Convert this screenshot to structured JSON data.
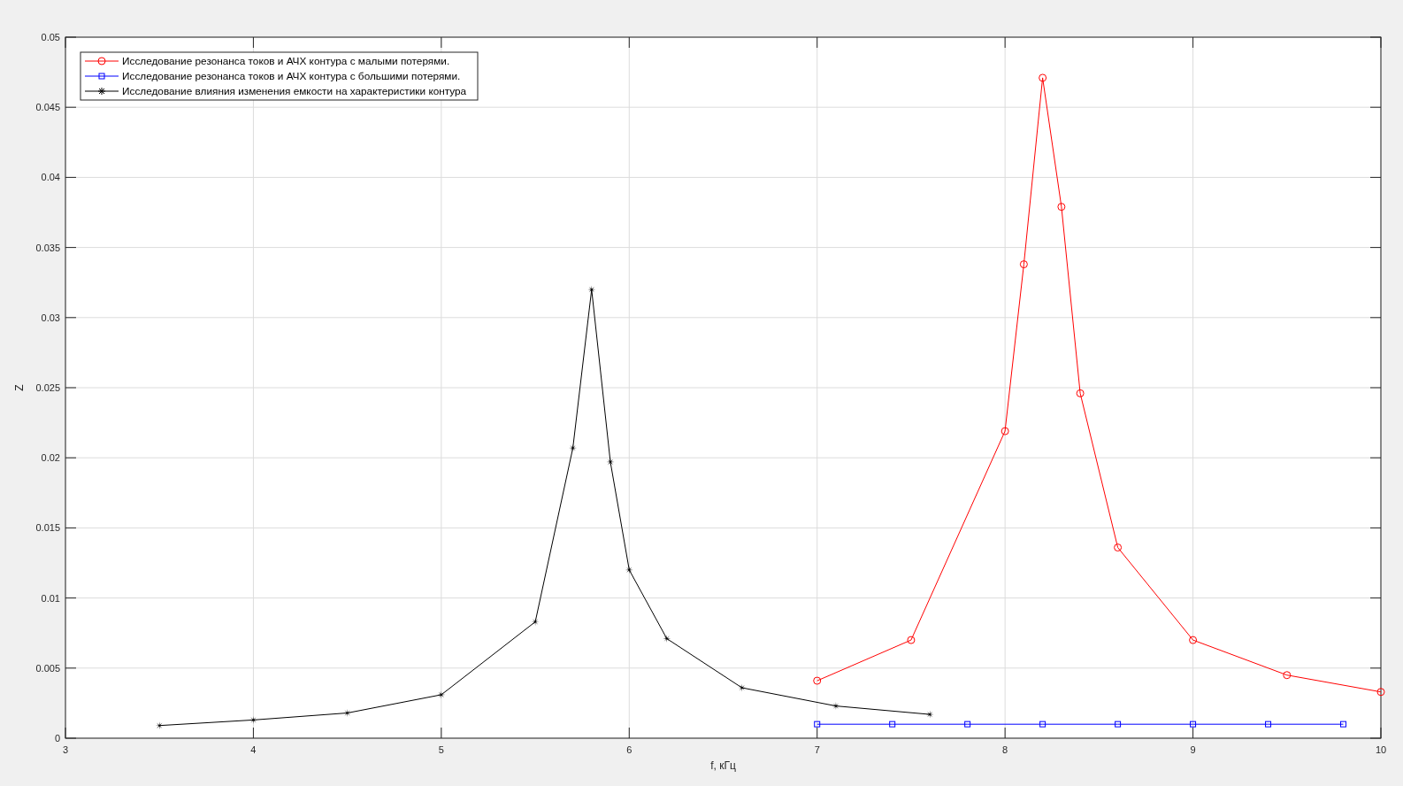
{
  "figure": {
    "chart_data": {
      "type": "line",
      "grid": true,
      "legend": true,
      "xlabel": "f, кГц",
      "ylabel": "Z",
      "xlim": [
        3,
        10
      ],
      "ylim": [
        0,
        0.05
      ],
      "xticks": [
        3,
        4,
        5,
        6,
        7,
        8,
        9,
        10
      ],
      "yticks": [
        0,
        0.005,
        0.01,
        0.015,
        0.02,
        0.025,
        0.03,
        0.035,
        0.04,
        0.045,
        0.05
      ],
      "series": [
        {
          "name": "Исследование резонанса токов и АЧХ контура с малыми потерями.",
          "color": "#ff0000",
          "marker": "circle",
          "x": [
            7,
            7.5,
            8,
            8.1,
            8.2,
            8.3,
            8.4,
            8.6,
            9,
            9.5,
            10
          ],
          "values": [
            0.0041,
            0.007,
            0.0219,
            0.0338,
            0.0471,
            0.0379,
            0.0246,
            0.0136,
            0.007,
            0.0045,
            0.0033
          ]
        },
        {
          "name": "Исследование резонанса токов и АЧХ контура с большими потерями.",
          "color": "#0000ff",
          "marker": "square",
          "x": [
            7,
            7.4,
            7.8,
            8.2,
            8.6,
            9,
            9.4,
            9.8
          ],
          "values": [
            0.001,
            0.001,
            0.001,
            0.001,
            0.001,
            0.001,
            0.001,
            0.001
          ]
        },
        {
          "name": "Исследование влияния изменения емкости на характеристики контура",
          "color": "#000000",
          "marker": "star",
          "x": [
            3.5,
            4,
            4.5,
            5,
            5.5,
            5.7,
            5.8,
            5.9,
            6,
            6.2,
            6.6,
            7.1,
            7.6
          ],
          "values": [
            0.0009,
            0.0013,
            0.0018,
            0.0031,
            0.0083,
            0.0207,
            0.032,
            0.0197,
            0.012,
            0.0071,
            0.0036,
            0.0023,
            0.0017
          ]
        }
      ]
    }
  }
}
